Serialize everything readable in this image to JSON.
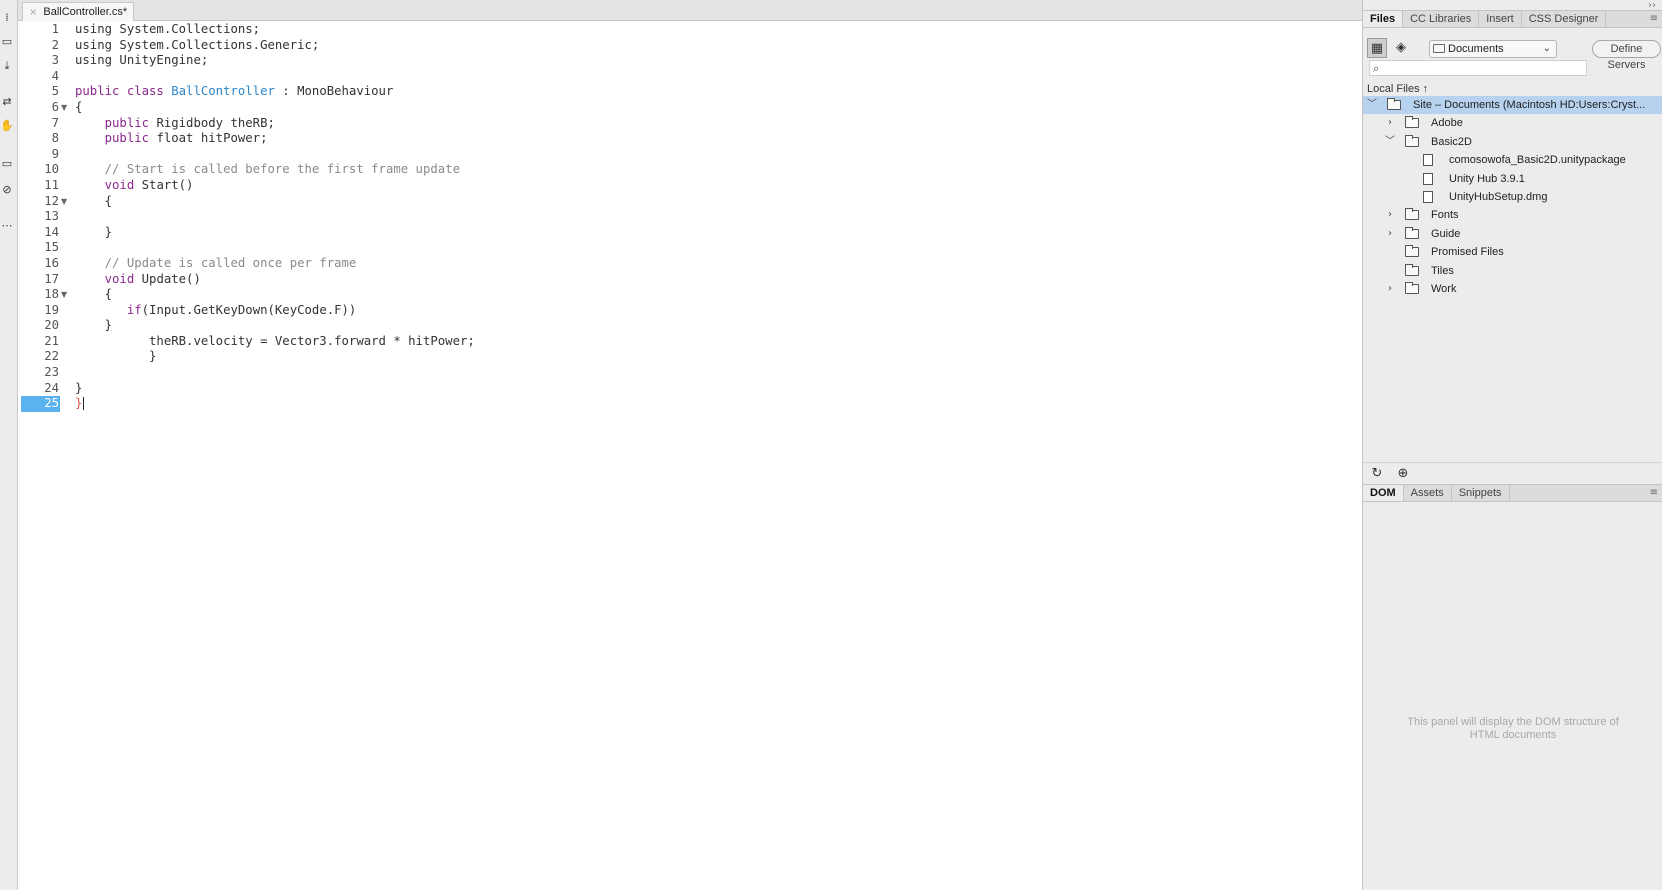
{
  "editor": {
    "tab_title": "BallController.cs*",
    "tab_close_glyph": "×",
    "current_line": 25
  },
  "code_lines": [
    {
      "n": "1",
      "fold": "",
      "tokens": [
        {
          "c": "",
          "t": "using System.Collections;"
        }
      ]
    },
    {
      "n": "2",
      "fold": "",
      "tokens": [
        {
          "c": "",
          "t": "using System.Collections.Generic;"
        }
      ]
    },
    {
      "n": "3",
      "fold": "",
      "tokens": [
        {
          "c": "",
          "t": "using UnityEngine;"
        }
      ]
    },
    {
      "n": "4",
      "fold": "",
      "tokens": []
    },
    {
      "n": "5",
      "fold": "",
      "tokens": [
        {
          "c": "kw",
          "t": "public class "
        },
        {
          "c": "cls",
          "t": "BallController"
        },
        {
          "c": "",
          "t": " : MonoBehaviour"
        }
      ]
    },
    {
      "n": "6",
      "fold": "▼",
      "tokens": [
        {
          "c": "",
          "t": "{"
        }
      ]
    },
    {
      "n": "7",
      "fold": "",
      "tokens": [
        {
          "c": "kw",
          "t": "    public "
        },
        {
          "c": "",
          "t": "Rigidbody theRB;"
        }
      ]
    },
    {
      "n": "8",
      "fold": "",
      "tokens": [
        {
          "c": "kw",
          "t": "    public "
        },
        {
          "c": "",
          "t": "float hitPower;"
        }
      ]
    },
    {
      "n": "9",
      "fold": "",
      "tokens": []
    },
    {
      "n": "10",
      "fold": "",
      "tokens": [
        {
          "c": "cmt",
          "t": "    // Start is called before the first frame update"
        }
      ]
    },
    {
      "n": "11",
      "fold": "",
      "tokens": [
        {
          "c": "kw",
          "t": "    void "
        },
        {
          "c": "",
          "t": "Start()"
        }
      ]
    },
    {
      "n": "12",
      "fold": "▼",
      "tokens": [
        {
          "c": "",
          "t": "    {"
        }
      ]
    },
    {
      "n": "13",
      "fold": "",
      "tokens": []
    },
    {
      "n": "14",
      "fold": "",
      "tokens": [
        {
          "c": "",
          "t": "    }"
        }
      ]
    },
    {
      "n": "15",
      "fold": "",
      "tokens": []
    },
    {
      "n": "16",
      "fold": "",
      "tokens": [
        {
          "c": "cmt",
          "t": "    // Update is called once per frame"
        }
      ]
    },
    {
      "n": "17",
      "fold": "",
      "tokens": [
        {
          "c": "kw",
          "t": "    void "
        },
        {
          "c": "",
          "t": "Update()"
        }
      ]
    },
    {
      "n": "18",
      "fold": "▼",
      "tokens": [
        {
          "c": "",
          "t": "    {"
        }
      ]
    },
    {
      "n": "19",
      "fold": "",
      "tokens": [
        {
          "c": "kw",
          "t": "       if"
        },
        {
          "c": "",
          "t": "(Input.GetKeyDown(KeyCode.F))"
        }
      ]
    },
    {
      "n": "20",
      "fold": "",
      "tokens": [
        {
          "c": "",
          "t": "    }"
        }
      ]
    },
    {
      "n": "21",
      "fold": "",
      "tokens": [
        {
          "c": "",
          "t": "          theRB.velocity = Vector3.forward * hitPower;"
        }
      ]
    },
    {
      "n": "22",
      "fold": "",
      "tokens": [
        {
          "c": "",
          "t": "          }"
        }
      ]
    },
    {
      "n": "23",
      "fold": "",
      "tokens": []
    },
    {
      "n": "24",
      "fold": "",
      "tokens": [
        {
          "c": "",
          "t": "}"
        }
      ]
    },
    {
      "n": "25",
      "fold": "",
      "tokens": [
        {
          "c": "brace-red",
          "t": "}"
        }
      ]
    }
  ],
  "right_panel": {
    "top_tabs": [
      "Files",
      "CC Libraries",
      "Insert",
      "CSS Designer"
    ],
    "active_top_tab": "Files",
    "site_select": "Documents",
    "define_servers_label": "Define Servers",
    "search_placeholder": "",
    "local_files_label": "Local Files ↑",
    "tree": [
      {
        "label": "Site – Documents (Macintosh HD:Users:Cryst...",
        "type": "site",
        "depth": 0,
        "arrow": "﹀",
        "selected": true
      },
      {
        "label": "Adobe",
        "type": "folder",
        "depth": 1,
        "arrow": "›",
        "selected": false
      },
      {
        "label": "Basic2D",
        "type": "folder",
        "depth": 1,
        "arrow": "﹀",
        "selected": false
      },
      {
        "label": "comosowofa_Basic2D.unitypackage",
        "type": "file",
        "depth": 2,
        "arrow": "",
        "selected": false
      },
      {
        "label": "Unity Hub 3.9.1",
        "type": "file",
        "depth": 2,
        "arrow": "",
        "selected": false
      },
      {
        "label": "UnityHubSetup.dmg",
        "type": "file",
        "depth": 2,
        "arrow": "",
        "selected": false
      },
      {
        "label": "Fonts",
        "type": "folder",
        "depth": 1,
        "arrow": "›",
        "selected": false
      },
      {
        "label": "Guide",
        "type": "folder",
        "depth": 1,
        "arrow": "›",
        "selected": false
      },
      {
        "label": "Promised Files",
        "type": "folder",
        "depth": 1,
        "arrow": "",
        "selected": false
      },
      {
        "label": "Tiles",
        "type": "folder",
        "depth": 1,
        "arrow": "",
        "selected": false
      },
      {
        "label": "Work",
        "type": "folder",
        "depth": 1,
        "arrow": "›",
        "selected": false
      }
    ],
    "bottom_tabs": [
      "DOM",
      "Assets",
      "Snippets"
    ],
    "active_bottom_tab": "DOM",
    "dom_message": "This panel will display the DOM structure of HTML documents"
  },
  "icons": {
    "refresh": "↻",
    "panel_menu": "≡",
    "collapse": "››",
    "search": "⌕",
    "select_arrow": "⌄"
  },
  "colors": {
    "current_line_bg": "#5ab3ef",
    "keyword": "#8b2a8e",
    "class_name": "#2e86c8",
    "comment": "#8a8a8a",
    "selection": "#b7d2ee"
  }
}
